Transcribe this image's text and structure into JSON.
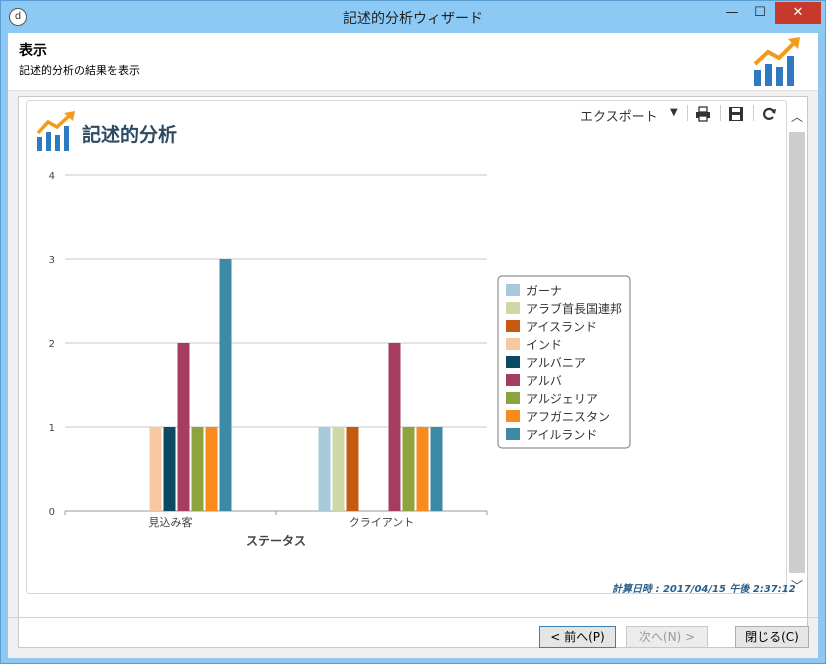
{
  "window": {
    "title": "記述的分析ウィザード",
    "icon": "app-icon",
    "min_label": "—",
    "max_label": "☐",
    "close_label": "✕"
  },
  "header": {
    "title": "表示",
    "subtitle": "記述的分析の結果を表示"
  },
  "toolbar": {
    "export_label": "エクスポート",
    "icons": [
      "print-icon",
      "save-icon",
      "refresh-icon"
    ]
  },
  "report": {
    "title": "記述的分析",
    "calc_time": "計算日時 : 2017/04/15 午後 2:37:12"
  },
  "chart_data": {
    "type": "bar",
    "categories": [
      "見込み客",
      "クライアント"
    ],
    "xlabel": "ステータス",
    "ylabel": "",
    "ylim": [
      0,
      4
    ],
    "yticks": [
      0,
      1,
      2,
      3,
      4
    ],
    "grid": true,
    "legend": "right",
    "series": [
      {
        "name": "ガーナ",
        "color": "#a8c9d9",
        "values": [
          0,
          1
        ]
      },
      {
        "name": "アラブ首長国連邦",
        "color": "#cdd7a8",
        "values": [
          0,
          1
        ]
      },
      {
        "name": "アイスランド",
        "color": "#c55a11",
        "values": [
          0,
          1
        ]
      },
      {
        "name": "インド",
        "color": "#f8c9a0",
        "values": [
          1,
          0
        ]
      },
      {
        "name": "アルバニア",
        "color": "#0b4a62",
        "values": [
          1,
          0
        ]
      },
      {
        "name": "アルバ",
        "color": "#a53d5e",
        "values": [
          2,
          2
        ]
      },
      {
        "name": "アルジェリア",
        "color": "#8ea33c",
        "values": [
          1,
          1
        ]
      },
      {
        "name": "アフガニスタン",
        "color": "#f98a1d",
        "values": [
          1,
          1
        ]
      },
      {
        "name": "アイルランド",
        "color": "#3d8aa6",
        "values": [
          3,
          1
        ]
      }
    ]
  },
  "buttons": {
    "prev": "< 前へ(P)",
    "next": "次へ(N) >",
    "close": "閉じる(C)"
  },
  "scrollbar": {
    "up": "︿",
    "down": "﹀"
  }
}
